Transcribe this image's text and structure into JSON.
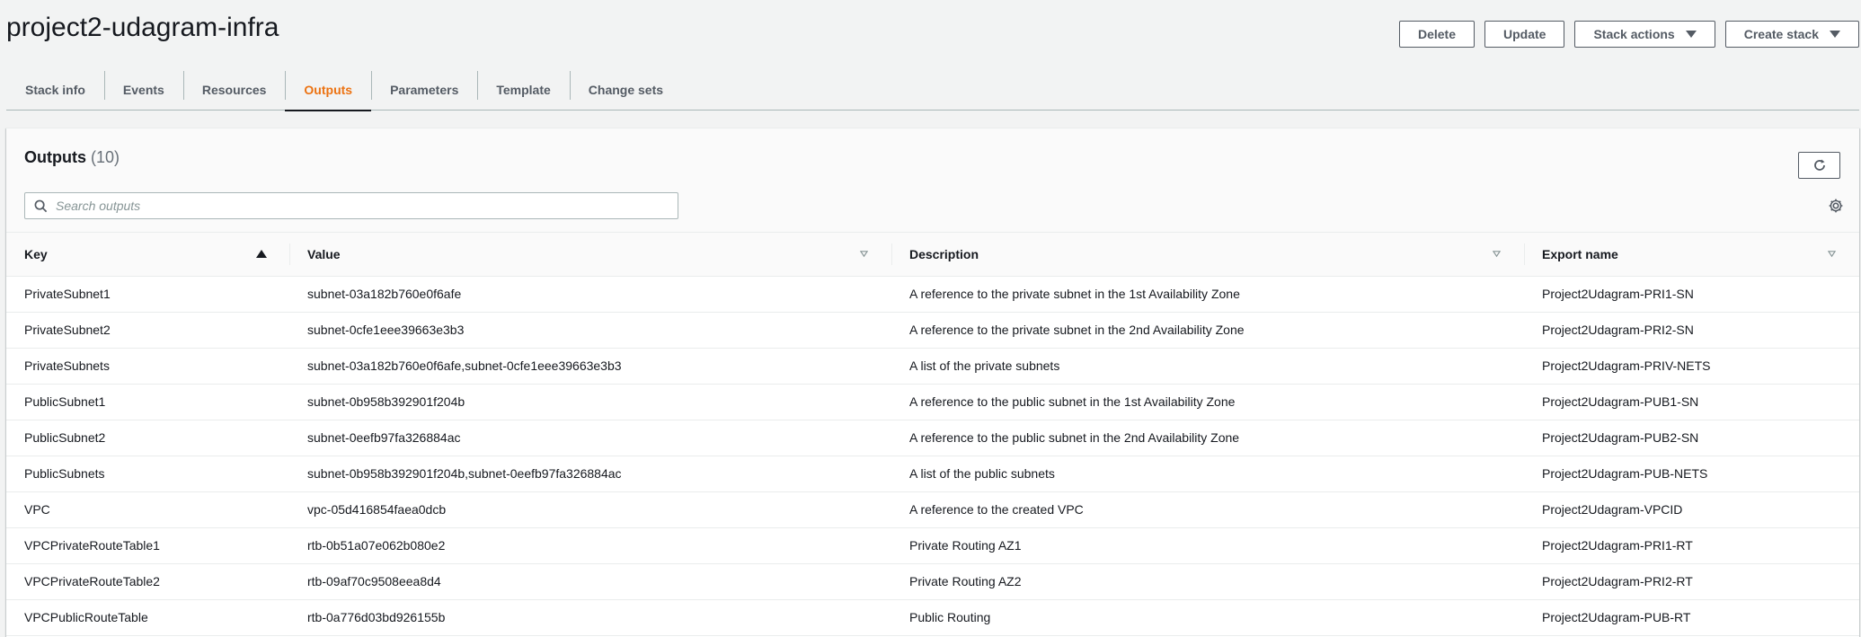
{
  "stack": {
    "title": "project2-udagram-infra"
  },
  "toolbar": {
    "delete_label": "Delete",
    "update_label": "Update",
    "stack_actions_label": "Stack actions",
    "create_stack_label": "Create stack"
  },
  "tabs": [
    {
      "label": "Stack info"
    },
    {
      "label": "Events"
    },
    {
      "label": "Resources"
    },
    {
      "label": "Outputs",
      "active": true
    },
    {
      "label": "Parameters"
    },
    {
      "label": "Template"
    },
    {
      "label": "Change sets"
    }
  ],
  "outputs": {
    "title": "Outputs",
    "count": "(10)",
    "search_placeholder": "Search outputs",
    "columns": [
      "Key",
      "Value",
      "Description",
      "Export name"
    ],
    "rows": [
      [
        "PrivateSubnet1",
        "subnet-03a182b760e0f6afe",
        "A reference to the private subnet in the 1st Availability Zone",
        "Project2Udagram-PRI1-SN"
      ],
      [
        "PrivateSubnet2",
        "subnet-0cfe1eee39663e3b3",
        "A reference to the private subnet in the 2nd Availability Zone",
        "Project2Udagram-PRI2-SN"
      ],
      [
        "PrivateSubnets",
        "subnet-03a182b760e0f6afe,subnet-0cfe1eee39663e3b3",
        "A list of the private subnets",
        "Project2Udagram-PRIV-NETS"
      ],
      [
        "PublicSubnet1",
        "subnet-0b958b392901f204b",
        "A reference to the public subnet in the 1st Availability Zone",
        "Project2Udagram-PUB1-SN"
      ],
      [
        "PublicSubnet2",
        "subnet-0eefb97fa326884ac",
        "A reference to the public subnet in the 2nd Availability Zone",
        "Project2Udagram-PUB2-SN"
      ],
      [
        "PublicSubnets",
        "subnet-0b958b392901f204b,subnet-0eefb97fa326884ac",
        "A list of the public subnets",
        "Project2Udagram-PUB-NETS"
      ],
      [
        "VPC",
        "vpc-05d416854faea0dcb",
        "A reference to the created VPC",
        "Project2Udagram-VPCID"
      ],
      [
        "VPCPrivateRouteTable1",
        "rtb-0b51a07e062b080e2",
        "Private Routing AZ1",
        "Project2Udagram-PRI1-RT"
      ],
      [
        "VPCPrivateRouteTable2",
        "rtb-09af70c9508eea8d4",
        "Private Routing AZ2",
        "Project2Udagram-PRI2-RT"
      ],
      [
        "VPCPublicRouteTable",
        "rtb-0a776d03bd926155b",
        "Public Routing",
        "Project2Udagram-PUB-RT"
      ]
    ]
  },
  "colors": {
    "accent_active_tab": "#ec7211",
    "background": "#f2f3f3",
    "text": "#16191f"
  }
}
